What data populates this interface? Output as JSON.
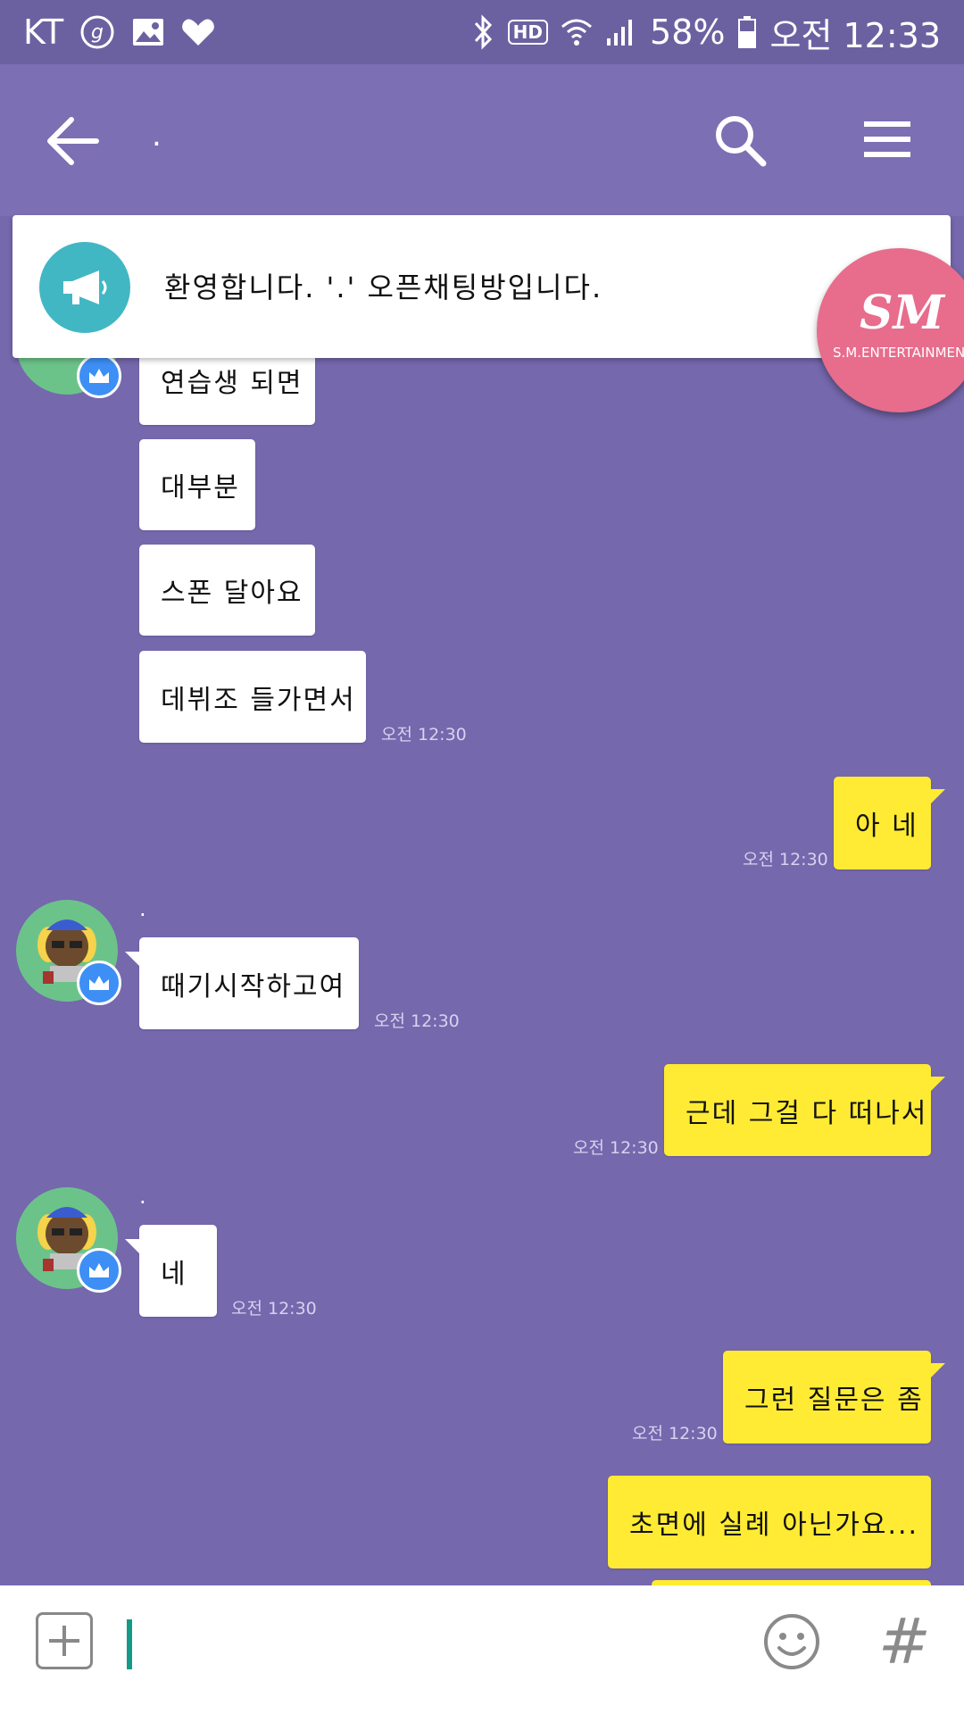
{
  "status_bar": {
    "carrier": "KT",
    "network_type": "HD",
    "battery": "58%",
    "time": "오전 12:33",
    "icons": [
      "g-icon",
      "gallery-icon",
      "heart-icon",
      "bluetooth-icon",
      "wifi-icon",
      "signal-icon",
      "battery-icon"
    ]
  },
  "header": {
    "title": ".",
    "back_icon": "back-arrow-icon",
    "search_icon": "search-icon",
    "menu_icon": "menu-icon"
  },
  "notice": {
    "text": "환영합니다. '.' 오픈채팅방입니다.",
    "icon": "megaphone-icon"
  },
  "badge": {
    "logo": "SM",
    "subtitle": "S.M.ENTERTAINMENT"
  },
  "messages": {
    "m1": "연습생 되면",
    "m2": "대부분",
    "m3": "스폰 달아요",
    "m4": "데뷔조 들가면서",
    "m4_time": "오전 12:30",
    "m5": "아 네",
    "m5_time": "오전 12:30",
    "m6_nick": ".",
    "m6": "때기시작하고여",
    "m6_time": "오전 12:30",
    "m7": "근데 그걸 다 떠나서",
    "m7_time": "오전 12:30",
    "m8_nick": ".",
    "m8": "네",
    "m8_time": "오전 12:30",
    "m9": "그런 질문은 좀",
    "m9_time": "오전 12:30",
    "m10": "초면에 실례 아닌가요..."
  },
  "input_bar": {
    "plus_icon": "plus-icon",
    "emoji_icon": "emoji-icon",
    "hash_label": "#"
  },
  "colors": {
    "background": "#7568ad",
    "header": "#7d6fb3",
    "my_bubble": "#ffeb33",
    "other_bubble": "#ffffff",
    "notice_icon": "#42b7c4",
    "badge": "#e86c8c",
    "crown_badge": "#3d8ff5",
    "cursor": "#149b88"
  }
}
